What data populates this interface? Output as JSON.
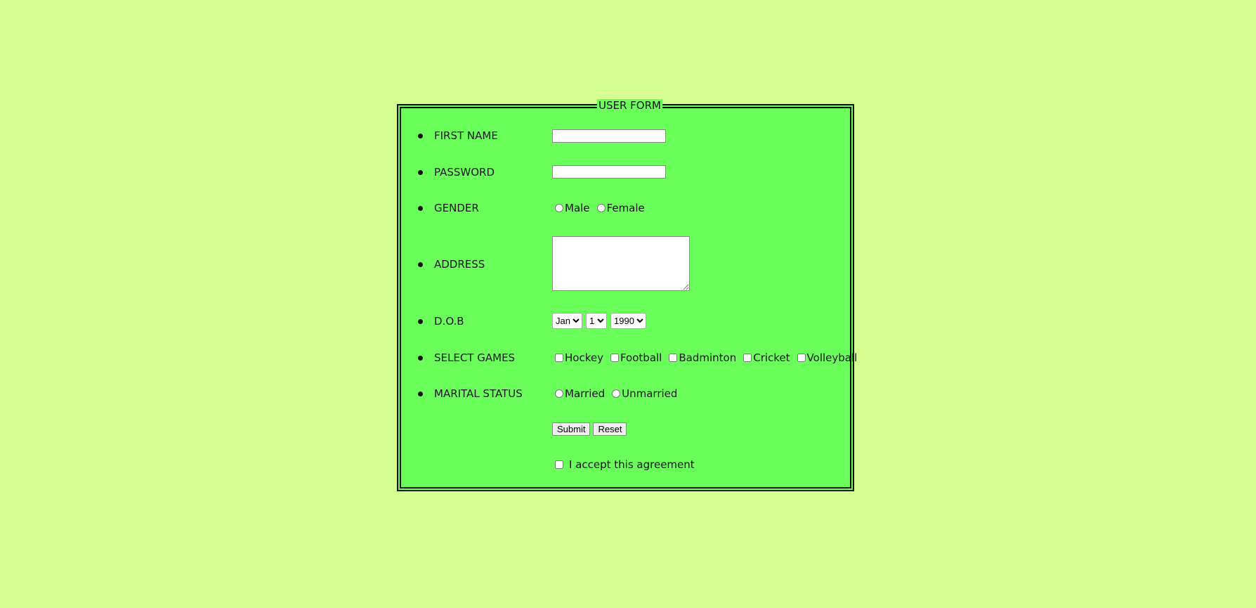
{
  "form": {
    "legend": "USER FORM",
    "first_name": {
      "label": "FIRST NAME",
      "value": ""
    },
    "password": {
      "label": "PASSWORD",
      "value": ""
    },
    "gender": {
      "label": "GENDER",
      "options": [
        "Male",
        "Female"
      ]
    },
    "address": {
      "label": "ADDRESS",
      "value": ""
    },
    "dob": {
      "label": "D.O.B",
      "month": "Jan",
      "day": "1",
      "year": "1990"
    },
    "games": {
      "label": "SELECT GAMES",
      "options": [
        "Hockey",
        "Football",
        "Badminton",
        "Cricket",
        "Volleyball"
      ]
    },
    "marital": {
      "label": "MARITAL STATUS",
      "options": [
        "Married",
        "Unmarried"
      ]
    },
    "submit_label": "Submit",
    "reset_label": "Reset",
    "agreement_label": "I accept this agreement"
  },
  "colors": {
    "page_bg": "#d5ff90",
    "form_bg": "#6aff5a"
  }
}
